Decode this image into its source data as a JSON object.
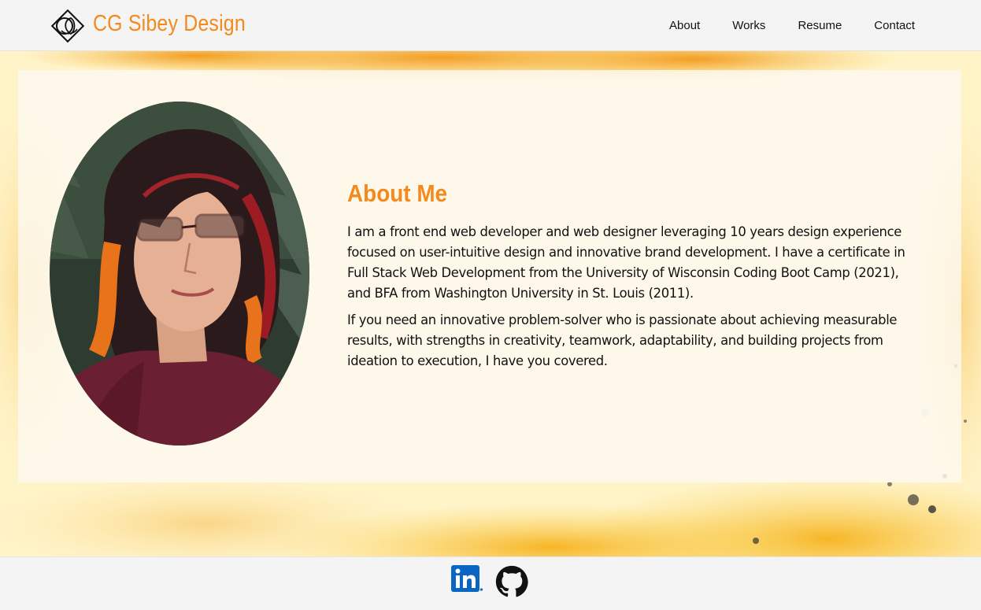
{
  "header": {
    "brand": "CG Sibey Design",
    "logo_icon": "cgs-monogram-logo-icon",
    "nav": [
      "About",
      "Works",
      "Resume",
      "Contact"
    ]
  },
  "about": {
    "title": "About Me",
    "paragraphs": [
      "I am a front end web developer and web designer leveraging 10 years design experience focused on user-intuitive design and innovative brand development. I have a certificate in Full Stack Web Development from the University of Wisconsin Coding Boot Camp (2021), and BFA from Washington University in St. Louis (2011).",
      "If you need an innovative problem-solver who is passionate about achieving measurable results, with strengths in creativity, teamwork, adaptability, and building projects from ideation to execution, I have you covered."
    ],
    "portrait_icon": "portrait-photo"
  },
  "footer": {
    "icons": [
      "linkedin-icon",
      "github-icon"
    ]
  },
  "colors": {
    "accent": "#f28a1e",
    "background": "#f4f4f4",
    "linkedin": "#0a66c2",
    "text": "#111111"
  }
}
